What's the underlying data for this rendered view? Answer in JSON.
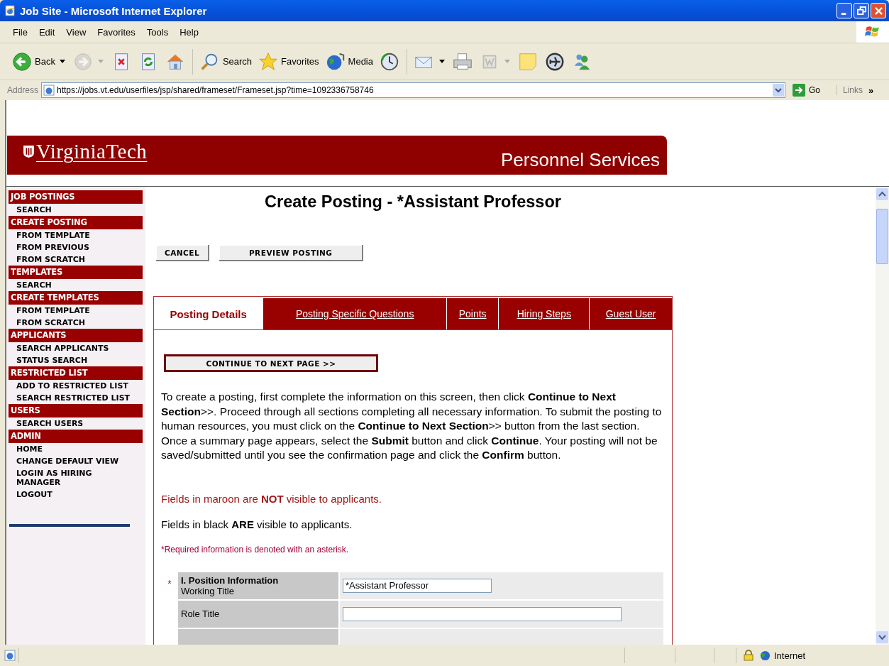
{
  "window": {
    "title": "Job Site - Microsoft Internet Explorer"
  },
  "menu": [
    "File",
    "Edit",
    "View",
    "Favorites",
    "Tools",
    "Help"
  ],
  "toolbar": [
    {
      "kind": "back",
      "label": "Back",
      "dropdown": true,
      "disabled": false
    },
    {
      "kind": "forward",
      "dropdown": true,
      "disabled": true
    },
    {
      "kind": "stop",
      "dropdown": false,
      "disabled": false
    },
    {
      "kind": "refresh",
      "dropdown": false,
      "disabled": false
    },
    {
      "kind": "home",
      "dropdown": false,
      "disabled": false
    },
    {
      "kind": "separator"
    },
    {
      "kind": "search",
      "label": "Search",
      "dropdown": false,
      "disabled": false
    },
    {
      "kind": "favorites",
      "label": "Favorites",
      "dropdown": false,
      "disabled": false
    },
    {
      "kind": "media",
      "label": "Media",
      "dropdown": false,
      "disabled": false
    },
    {
      "kind": "history",
      "dropdown": false,
      "disabled": false
    },
    {
      "kind": "separator"
    },
    {
      "kind": "mail",
      "dropdown": true,
      "disabled": false
    },
    {
      "kind": "print",
      "dropdown": false,
      "disabled": false
    },
    {
      "kind": "edit",
      "dropdown": true,
      "disabled": true
    },
    {
      "kind": "note",
      "dropdown": false,
      "disabled": false
    },
    {
      "kind": "plane",
      "dropdown": false,
      "disabled": false
    },
    {
      "kind": "messenger",
      "dropdown": false,
      "disabled": false
    }
  ],
  "address": {
    "label": "Address",
    "url": "https://jobs.vt.edu/userfiles/jsp/shared/frameset/Frameset.jsp?time=1092336758746",
    "go": "Go",
    "links": "Links",
    "more": "»"
  },
  "banner": {
    "logo": "VirginiaTech",
    "title": "Personnel Services"
  },
  "sidebar": [
    {
      "title": "JOB POSTINGS",
      "items": [
        "SEARCH"
      ]
    },
    {
      "title": "CREATE POSTING",
      "items": [
        "FROM TEMPLATE",
        "FROM PREVIOUS",
        "FROM SCRATCH"
      ]
    },
    {
      "title": "TEMPLATES",
      "items": [
        "SEARCH"
      ]
    },
    {
      "title": "CREATE TEMPLATES",
      "items": [
        "FROM TEMPLATE",
        "FROM SCRATCH"
      ]
    },
    {
      "title": "APPLICANTS",
      "items": [
        "SEARCH APPLICANTS",
        "STATUS SEARCH"
      ]
    },
    {
      "title": "RESTRICTED LIST",
      "items": [
        "ADD TO RESTRICTED LIST",
        "SEARCH RESTRICTED LIST"
      ]
    },
    {
      "title": "USERS",
      "items": [
        "SEARCH USERS"
      ]
    },
    {
      "title": "ADMIN",
      "items": [
        "HOME",
        "CHANGE DEFAULT VIEW",
        "LOGIN AS HIRING MANAGER",
        "LOGOUT"
      ]
    }
  ],
  "page_title": "Create Posting - *Assistant Professor",
  "buttons": [
    "CANCEL",
    "PREVIEW POSTING"
  ],
  "tabs": [
    {
      "label": "Posting Details",
      "selected": true
    },
    {
      "label": "Posting Specific Questions",
      "selected": false
    },
    {
      "label": "Points",
      "selected": false
    },
    {
      "label": "Hiring Steps",
      "selected": false
    },
    {
      "label": "Guest User",
      "selected": false
    }
  ],
  "continue_button": "CONTINUE TO NEXT PAGE >>",
  "instructions": "To create a posting, first complete the information on this screen, then click **Continue to Next Section**>>. Proceed through all sections completing all necessary information. To submit the posting to human resources, you must click on the **Continue to Next Section**>> button from the last section. Once a summary page appears, select the **Submit** button and click **Continue**. Your posting will not be saved/submitted until you see the confirmation page and click the **Confirm** button.",
  "notes": [
    {
      "kind": "hidden",
      "text": "Fields in maroon are **NOT** visible to applicants."
    },
    {
      "kind": "visible",
      "text": "Fields in black **ARE** visible to applicants."
    },
    {
      "kind": "required",
      "text": "*Required information is denoted with an asterisk."
    }
  ],
  "required_mark": "*",
  "form_rows": [
    {
      "section": "I. Position Information",
      "label": "Working Title",
      "required": true,
      "value": "*Assistant Professor",
      "kind": "short_field"
    },
    {
      "label": "Role Title",
      "required": false,
      "kind": "long_field"
    }
  ],
  "status_bar": {
    "zone": "Internet"
  }
}
